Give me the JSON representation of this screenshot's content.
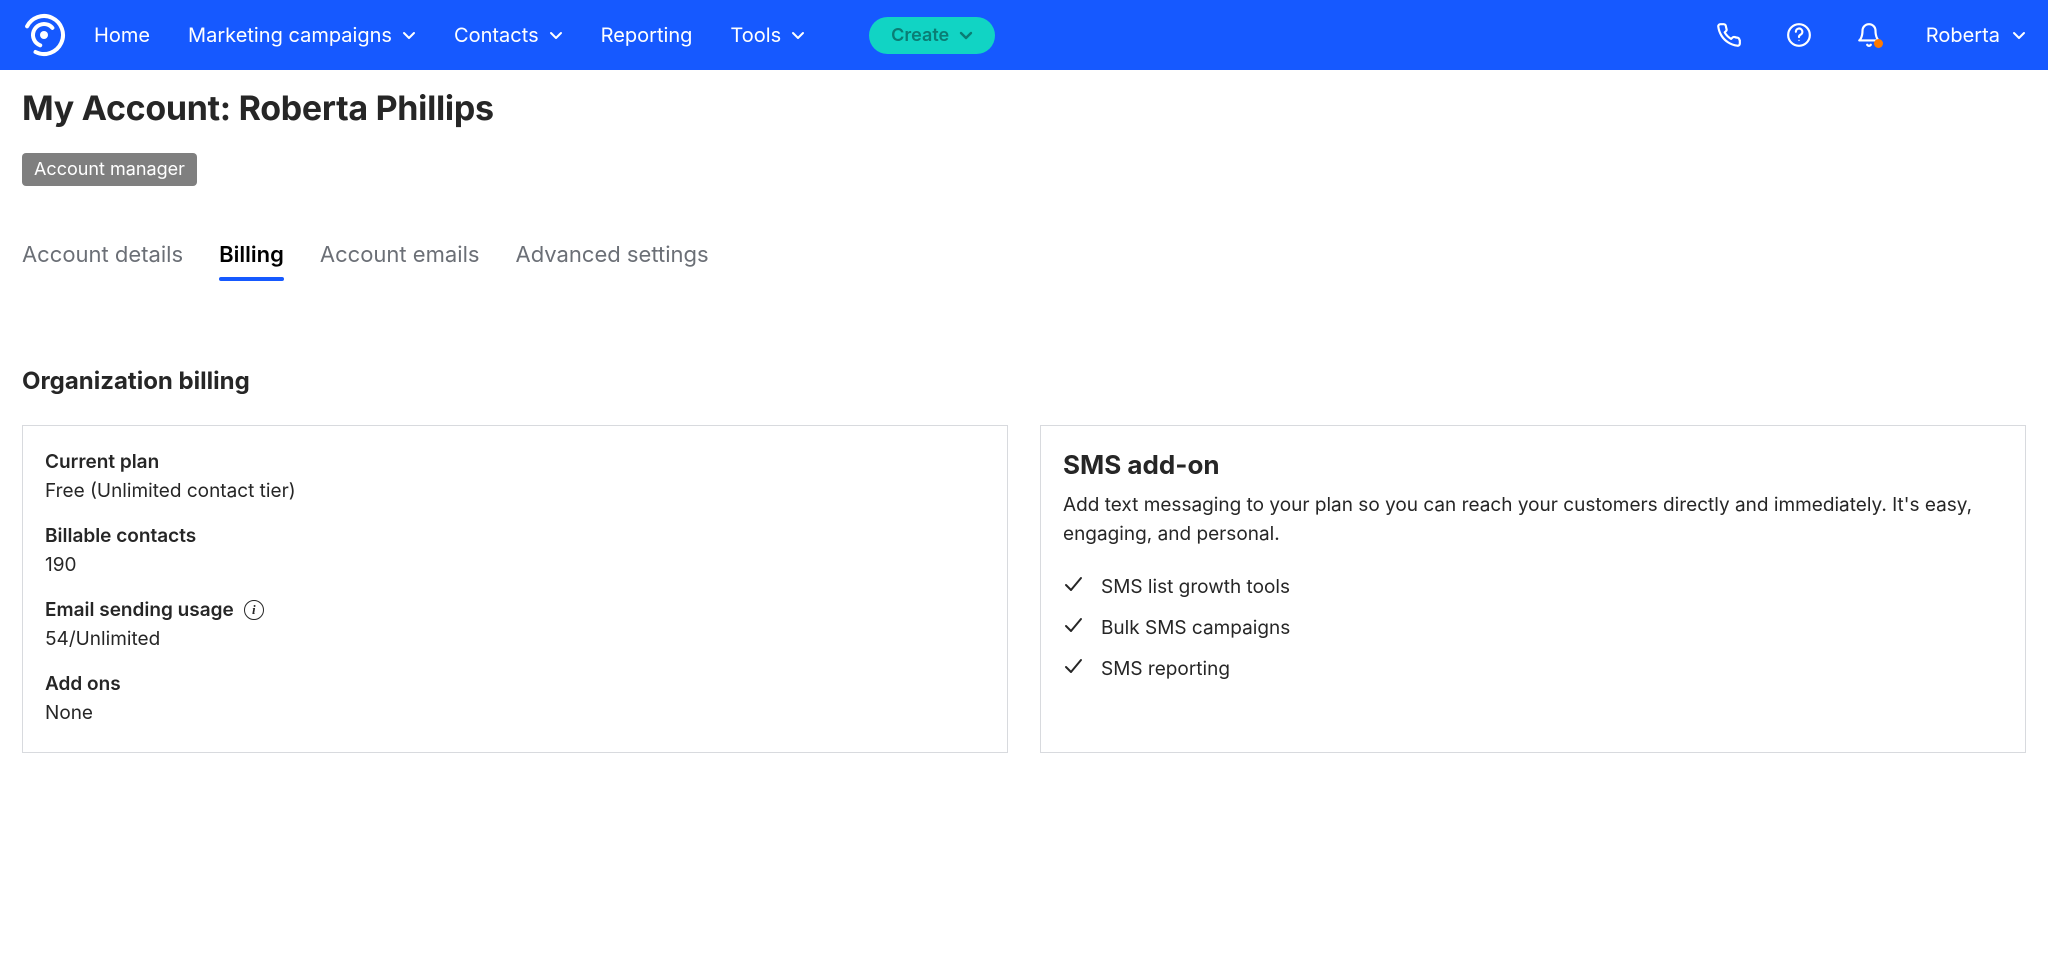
{
  "nav": {
    "items": [
      {
        "label": "Home",
        "dropdown": false
      },
      {
        "label": "Marketing campaigns",
        "dropdown": true
      },
      {
        "label": "Contacts",
        "dropdown": true
      },
      {
        "label": "Reporting",
        "dropdown": false
      },
      {
        "label": "Tools",
        "dropdown": true
      }
    ],
    "create_label": "Create",
    "user_label": "Roberta"
  },
  "page": {
    "title": "My Account: Roberta Phillips",
    "role_badge": "Account manager"
  },
  "tabs": [
    {
      "label": "Account details",
      "active": false
    },
    {
      "label": "Billing",
      "active": true
    },
    {
      "label": "Account emails",
      "active": false
    },
    {
      "label": "Advanced settings",
      "active": false
    }
  ],
  "billing": {
    "section_heading": "Organization billing",
    "plan": {
      "label": "Current plan",
      "value": "Free (Unlimited contact tier)"
    },
    "contacts": {
      "label": "Billable contacts",
      "value": "190"
    },
    "usage": {
      "label": "Email sending usage",
      "value": "54/Unlimited"
    },
    "addons": {
      "label": "Add ons",
      "value": "None"
    }
  },
  "sms_addon": {
    "title": "SMS add-on",
    "description": "Add text messaging to your plan so you can reach your customers directly and immediately. It's easy, engaging, and personal.",
    "features": [
      "SMS list growth tools",
      "Bulk SMS campaigns",
      "SMS reporting"
    ]
  }
}
